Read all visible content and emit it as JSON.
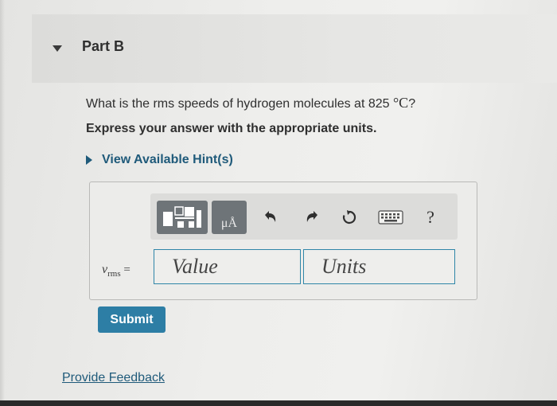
{
  "part": {
    "title": "Part B"
  },
  "question": {
    "text": "What is the rms speeds of hydrogen molecules at 825 ",
    "unit": "°C",
    "end": "?"
  },
  "instruction": "Express your answer with the appropriate units.",
  "hint": {
    "label": "View Available Hint(s)"
  },
  "toolbar": {
    "units_button": "μÅ",
    "help": "?",
    "icons": [
      "templates-icon",
      "units-icon",
      "undo-icon",
      "redo-icon",
      "reset-icon",
      "keyboard-icon",
      "help-icon"
    ]
  },
  "answer": {
    "var_symbol": "v",
    "var_sub": "rms",
    "equals": "=",
    "value_placeholder": "Value",
    "units_placeholder": "Units"
  },
  "submit_label": "Submit",
  "feedback_label": "Provide Feedback",
  "colors": {
    "accent": "#2d7ea5",
    "link": "#1f5a7a",
    "toolbar_button": "#6e7478",
    "field_border": "#2f86a8"
  }
}
